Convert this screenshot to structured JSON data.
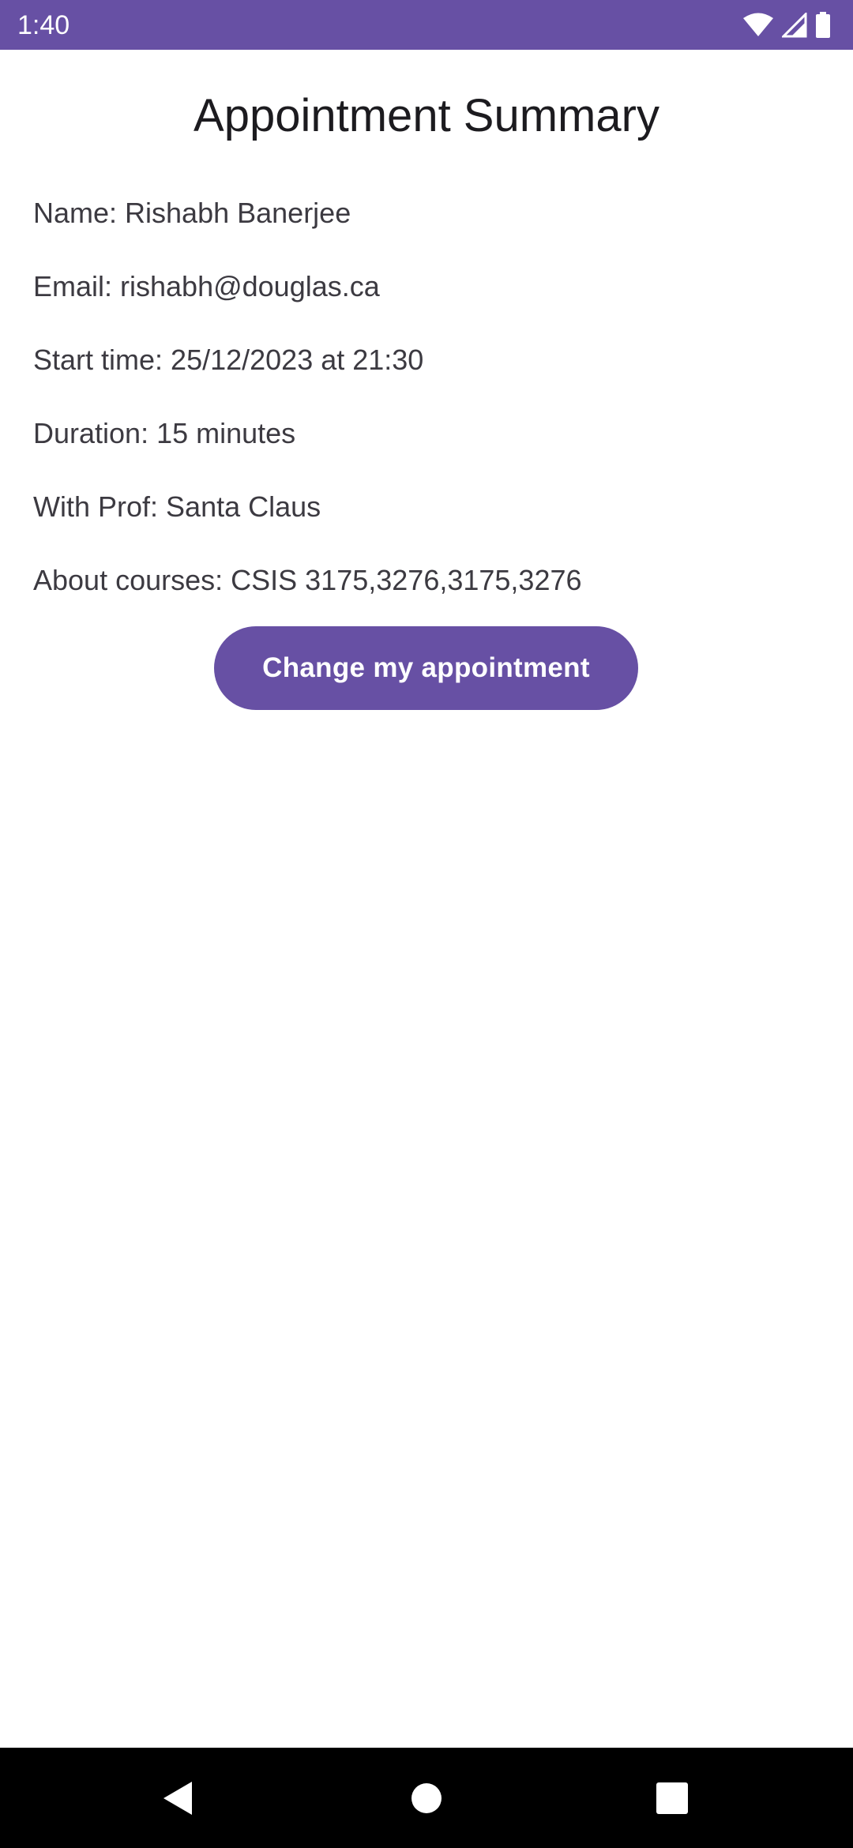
{
  "status_bar": {
    "time": "1:40",
    "color": "#6750a4",
    "icons": [
      "wifi-icon",
      "cellular-signal-icon",
      "battery-icon"
    ]
  },
  "summary": {
    "title": "Appointment Summary",
    "name_line": "Name: Rishabh Banerjee",
    "email_line": "Email: rishabh@douglas.ca",
    "start_time_line": "Start time: 25/12/2023 at 21:30",
    "duration_line": "Duration: 15 minutes",
    "professor_line": "With Prof: Santa Claus",
    "courses_line": "About courses: CSIS 3175,3276,3175,3276"
  },
  "actions": {
    "change_label": "Change my appointment",
    "button_color": "#6750a4"
  },
  "navigation_bar": {
    "icons": [
      "back-icon",
      "home-icon",
      "recents-icon"
    ]
  }
}
